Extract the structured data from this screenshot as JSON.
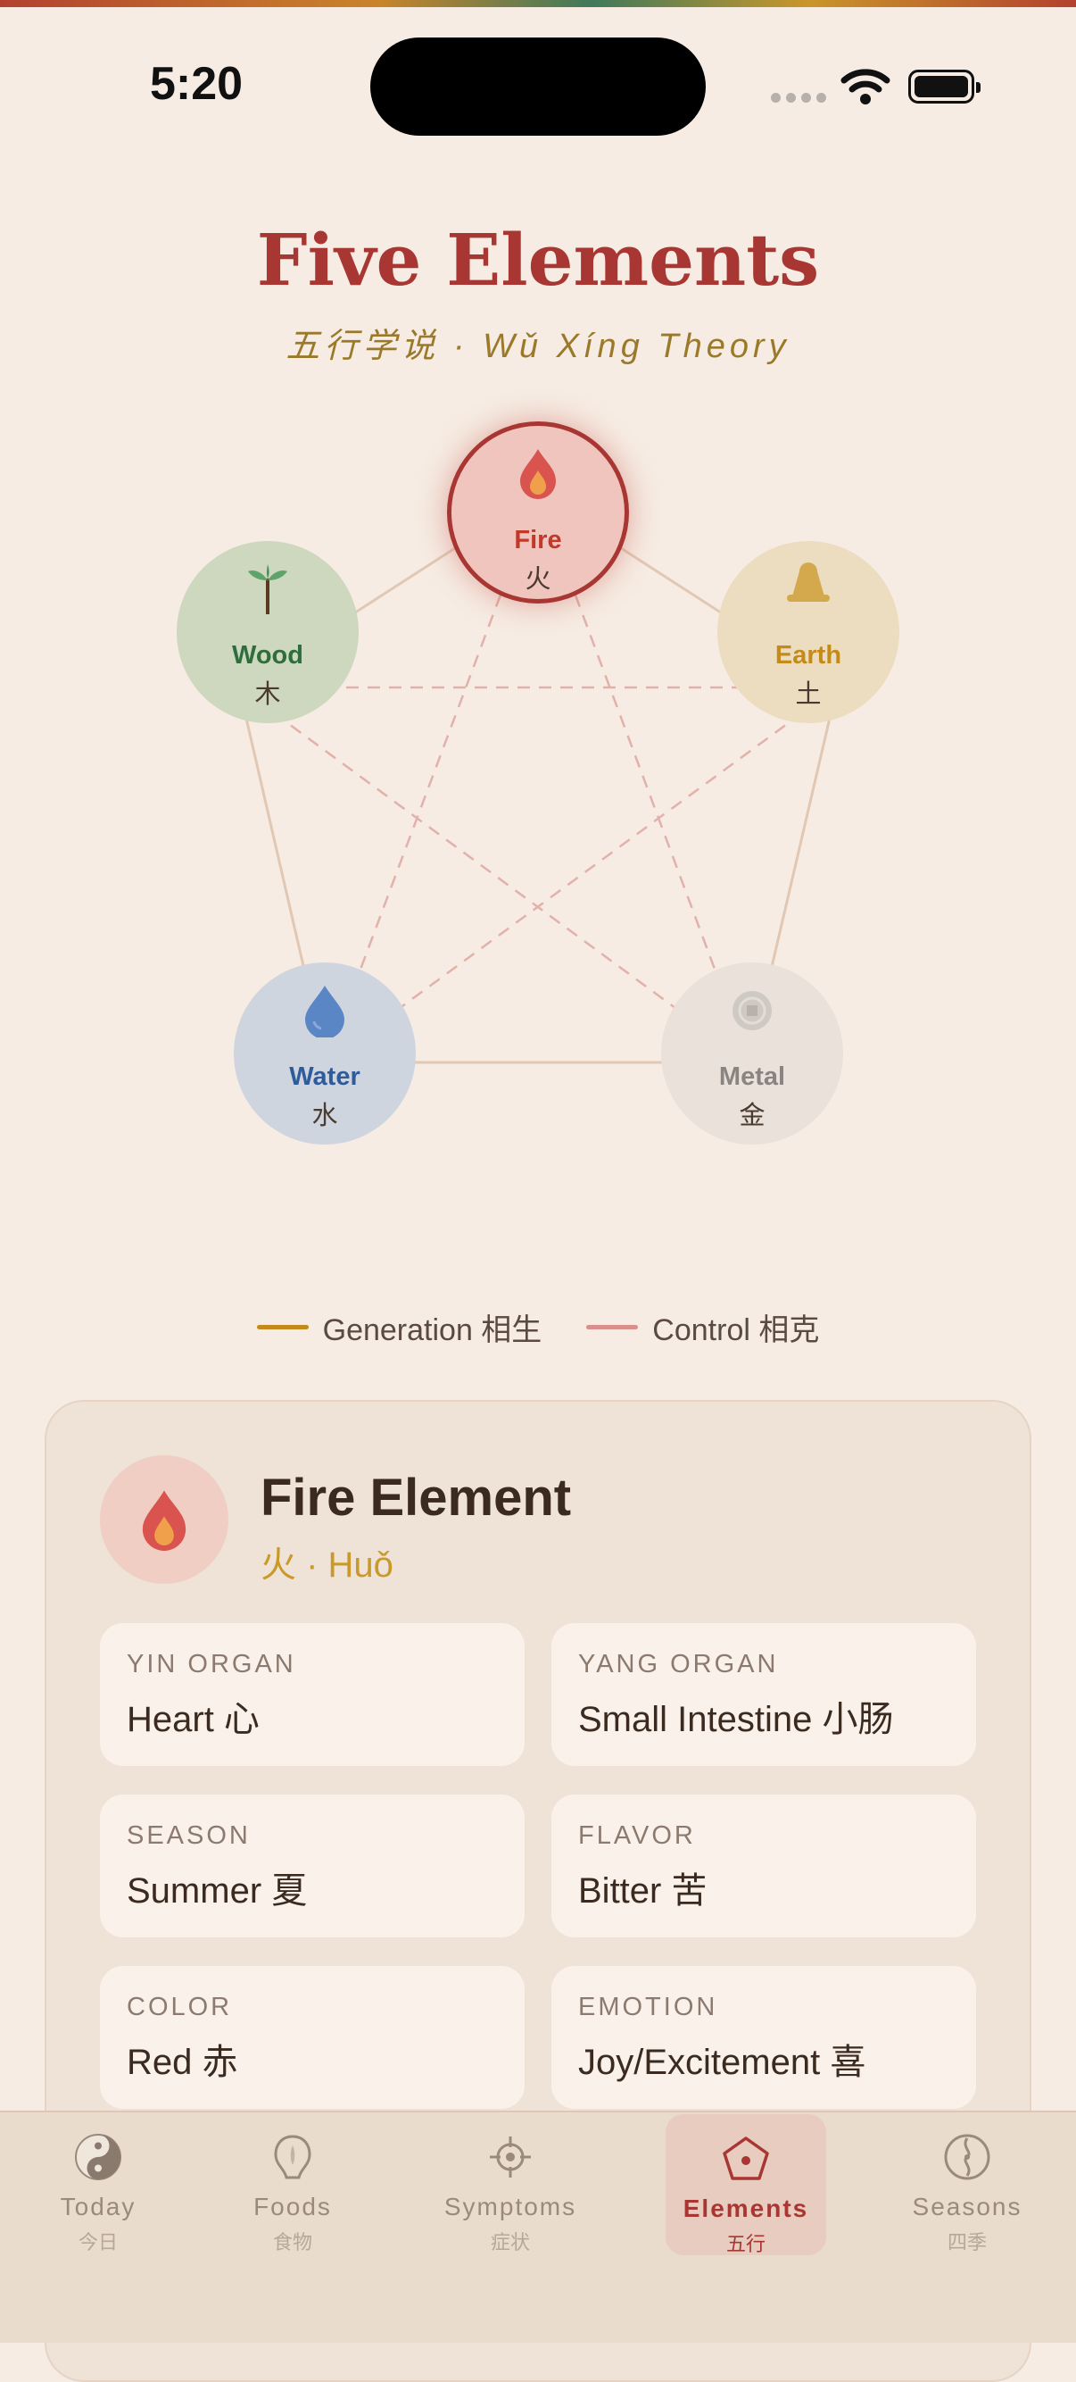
{
  "status": {
    "time": "5:20"
  },
  "header": {
    "title": "Five Elements",
    "subtitle": "五行学说 · Wǔ Xíng Theory"
  },
  "elements": {
    "fire": {
      "name": "Fire",
      "zh": "火",
      "selected": true,
      "color": "#c0392b"
    },
    "wood": {
      "name": "Wood",
      "zh": "木",
      "selected": false,
      "color": "#2f6e3c"
    },
    "earth": {
      "name": "Earth",
      "zh": "土",
      "selected": false,
      "color": "#c48a1a"
    },
    "water": {
      "name": "Water",
      "zh": "水",
      "selected": false,
      "color": "#2f5b9a"
    },
    "metal": {
      "name": "Metal",
      "zh": "金",
      "selected": false,
      "color": "#8a8480"
    }
  },
  "legend": {
    "generation": "Generation 相生",
    "control": "Control 相克"
  },
  "detail": {
    "title": "Fire Element",
    "subtitle": "火 · Huǒ",
    "properties": [
      {
        "label": "YIN ORGAN",
        "value": "Heart 心"
      },
      {
        "label": "YANG ORGAN",
        "value": "Small Intestine 小肠"
      },
      {
        "label": "SEASON",
        "value": "Summer 夏"
      },
      {
        "label": "FLAVOR",
        "value": "Bitter 苦"
      },
      {
        "label": "COLOR",
        "value": "Red 赤"
      },
      {
        "label": "EMOTION",
        "value": "Joy/Excitement 喜"
      }
    ]
  },
  "tabs": [
    {
      "label": "Today",
      "zh": "今日",
      "icon": "yin-yang-icon",
      "active": false
    },
    {
      "label": "Foods",
      "zh": "食物",
      "icon": "food-icon",
      "active": false
    },
    {
      "label": "Symptoms",
      "zh": "症状",
      "icon": "target-icon",
      "active": false
    },
    {
      "label": "Elements",
      "zh": "五行",
      "icon": "pentagon-icon",
      "active": true
    },
    {
      "label": "Seasons",
      "zh": "四季",
      "icon": "compass-icon",
      "active": false
    }
  ]
}
